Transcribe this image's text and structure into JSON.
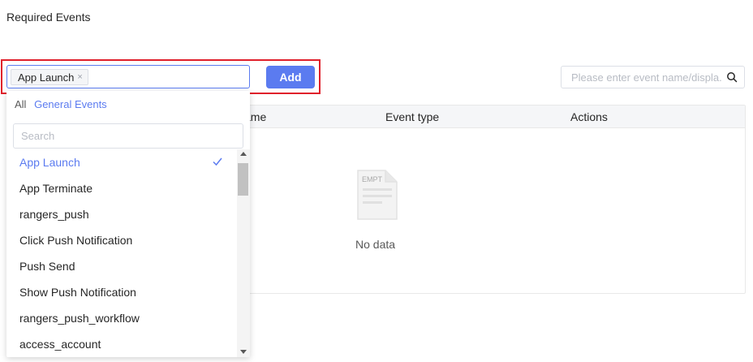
{
  "page": {
    "title": "Required Events"
  },
  "selector": {
    "selected_tag": "App Launch",
    "tag_close": "×",
    "add_label": "Add"
  },
  "search": {
    "placeholder": "Please enter event name/displa."
  },
  "table": {
    "headers": [
      "ame",
      "Event type",
      "Actions"
    ],
    "empty_icon_text": "EMPT",
    "empty_text": "No data"
  },
  "dropdown": {
    "tab_all": "All",
    "tab_general": "General Events",
    "search_placeholder": "Search",
    "items": [
      {
        "label": "App Launch",
        "selected": true
      },
      {
        "label": "App Terminate"
      },
      {
        "label": "rangers_push"
      },
      {
        "label": "Click Push Notification"
      },
      {
        "label": "Push Send"
      },
      {
        "label": "Show Push Notification"
      },
      {
        "label": "rangers_push_workflow"
      },
      {
        "label": "access_account"
      }
    ]
  },
  "colors": {
    "accent": "#5b7bf0",
    "highlight": "#e0202b"
  }
}
